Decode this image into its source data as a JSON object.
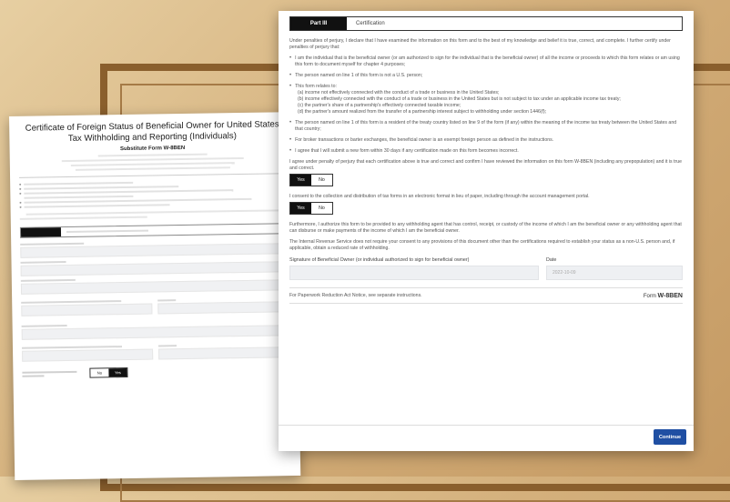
{
  "right": {
    "part_label": "Part III",
    "part_title": "Certification",
    "intro": "Under penalties of perjury, I declare that I have examined the information on this form and to the best of my knowledge and belief it is true, correct, and complete. I further certify under penalties of perjury that:",
    "bullets": [
      "I am the individual that is the beneficial owner (or am authorized to sign for the individual that is the beneficial owner) of all the income or proceeds to which this form relates or am using this form to document myself for chapter 4 purposes;",
      "The person named on line 1 of this form is not a U.S. person;",
      "This form relates to:"
    ],
    "subitems": [
      "(a) income not effectively connected with the conduct of a trade or business in the United States;",
      "(b) income effectively connected with the conduct of a trade or business in the United States but is not subject to tax under an applicable income tax treaty;",
      "(c) the partner's share of a partnership's effectively connected taxable income;",
      "(d) the partner's amount realized from the transfer of a partnership interest subject to withholding under section 1446(f);"
    ],
    "bullets2": [
      "The person named on line 1 of this form is a resident of the treaty country listed on line 9 of the form (if any) within the meaning of the income tax treaty between the United States and that country;",
      "For broker transactions or barter exchanges, the beneficial owner is an exempt foreign person as defined in the instructions.",
      "I agree that I will submit a new form within 30 days if any certification made on this form becomes incorrect."
    ],
    "agree_text": "I agree under penalty of perjury that each certification above is true and correct and confirm I have reviewed the information on this form W-8BEN (including any prepopulation) and it is true and correct.",
    "consent_text": "I consent to the collection and distribution of tax forms in an electronic format in lieu of paper, including through the account management portal.",
    "yes_label": "Yes",
    "no_label": "No",
    "authorize_text": "Furthermore, I authorize this form to be provided to any withholding agent that has control, receipt, or custody of the income of which I am the beneficial owner or any withholding agent that can disburse or make payments of the income of which I am the beneficial owner.",
    "irs_text": "The Internal Revenue Service does not require your consent to any provisions of this document other than the certifications required to establish your status as a non-U.S. person and, if applicable, obtain a reduced rate of withholding.",
    "signature_label": "Signature of Beneficial Owner (or individual authorized to sign for beneficial owner)",
    "date_label": "Date",
    "date_value": "2022-10-09",
    "paperwork_text": "For Paperwork Reduction Act Notice, see separate instructions.",
    "form_prefix": "Form",
    "form_name": "W-8BEN",
    "continue_label": "Continue"
  },
  "left": {
    "title": "Certificate of Foreign Status of Beneficial Owner for United States Tax Withholding and Reporting (Individuals)",
    "substitute": "Substitute Form W-8BEN",
    "yes_label": "Yes",
    "no_label": "No"
  }
}
